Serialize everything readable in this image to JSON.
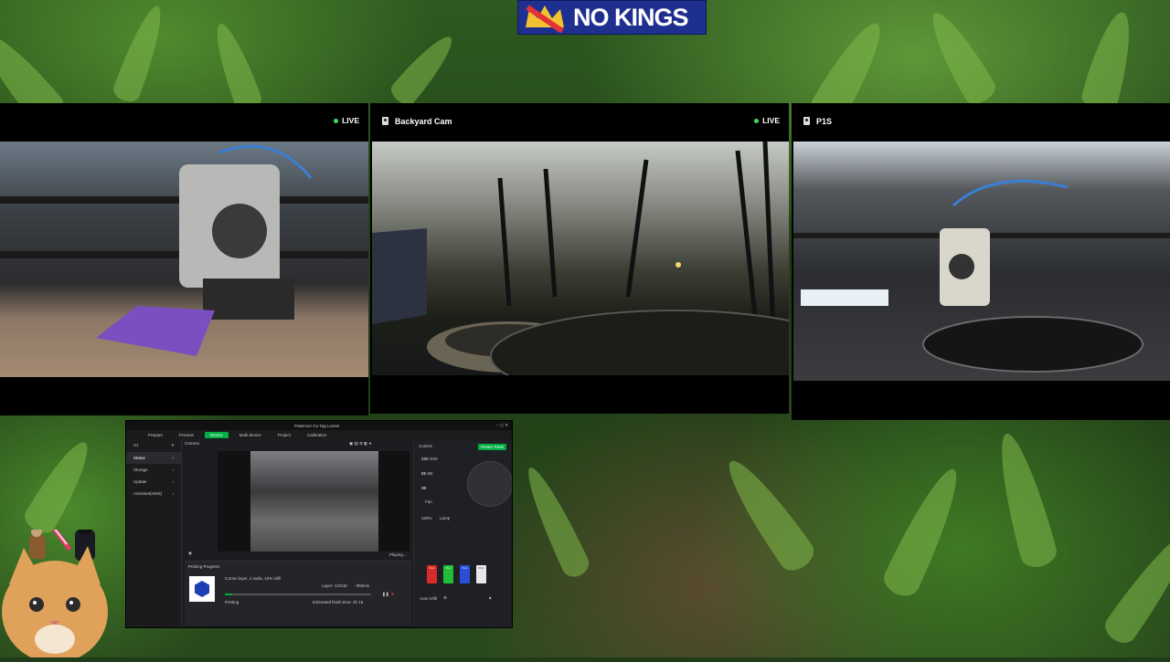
{
  "banner": {
    "logo_text": "NO KINGS",
    "logo_colors": {
      "bg": "#1f2f8f",
      "crown": "#e4323a",
      "crown_gold": "#f2c230"
    }
  },
  "cameras": [
    {
      "name": "",
      "live_label": "LIVE",
      "icon": "camera-icon"
    },
    {
      "name": "Backyard Cam",
      "live_label": "LIVE",
      "icon": "camera-icon"
    },
    {
      "name": "P1S",
      "live_label": "",
      "icon": "camera-icon"
    }
  ],
  "slicer": {
    "title": "Pokemon Go Tag Locker",
    "tabs": [
      "Prepare",
      "Preview",
      "Device",
      "Multi-device",
      "Project",
      "Calibration"
    ],
    "active_tab": "Device",
    "device_name": "X1",
    "sidebar": [
      "Status",
      "Storage",
      "Update",
      "Assistant(HMS)"
    ],
    "selected_sidebar": "Status",
    "camera_label": "Camera",
    "playing_label": "Playing...",
    "progress": {
      "heading": "Printing Progress",
      "job": "0.2mm layer, 2 walls, 10% infill",
      "status": "Printing",
      "layer": "Layer: 12/240",
      "remaining": "-3h6min",
      "finish": "Estimated finish time: 3h 19"
    },
    "control": {
      "heading": "Control",
      "printer_parts": "Printer Parts",
      "nozzle_temp": "220",
      "nozzle_target": "/220",
      "bed_temp": "55",
      "bed_target": "/55",
      "chamber_temp": "38",
      "fan_label": "Fan",
      "fan_value": "100%",
      "lamp_label": "Lamp",
      "auto_refill": "Auto-refill"
    },
    "ams": [
      {
        "label": "PLA",
        "color": "#d92b2b"
      },
      {
        "label": "PLA",
        "color": "#1fbf3a"
      },
      {
        "label": "PLA",
        "color": "#2a4fd6"
      },
      {
        "label": "PLA",
        "color": "#e8e8e8"
      }
    ]
  }
}
